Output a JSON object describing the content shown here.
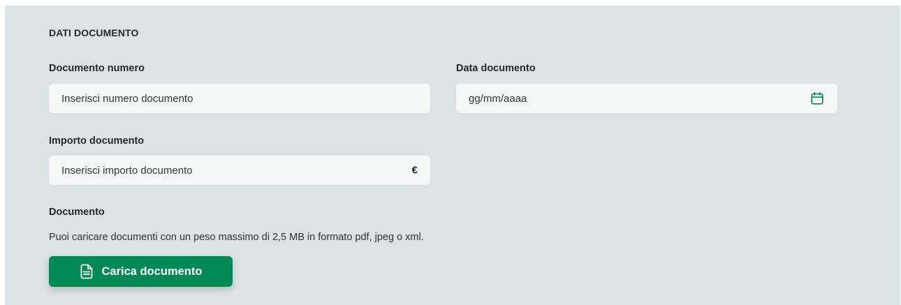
{
  "section": {
    "title": "DATI DOCUMENTO"
  },
  "fields": {
    "numero": {
      "label": "Documento numero",
      "placeholder": "Inserisci numero documento"
    },
    "data": {
      "label": "Data documento",
      "placeholder": "gg/mm/aaaa",
      "icon": "calendar-icon"
    },
    "importo": {
      "label": "Importo documento",
      "placeholder": "Inserisci importo documento",
      "suffix": "€"
    }
  },
  "upload": {
    "label": "Documento",
    "hint": "Puoi caricare documenti con un peso massimo di 2,5 MB in formato pdf, jpeg o xml.",
    "button_label": "Carica documento",
    "button_icon": "file-text-icon"
  },
  "colors": {
    "panel_bg": "#dce3e4",
    "field_bg": "#f5f7f7",
    "accent": "#008855"
  }
}
